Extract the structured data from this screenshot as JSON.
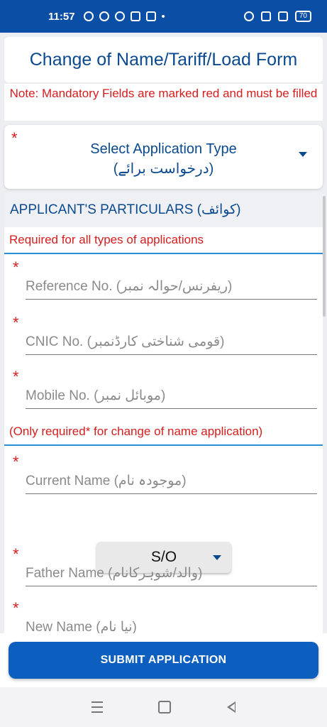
{
  "status": {
    "time": "11:57",
    "battery": "70"
  },
  "form": {
    "title": "Change of Name/Tariff/Load Form",
    "note": "Note: Mandatory Fields are marked red and must be filled"
  },
  "application_type": {
    "asterisk": "*",
    "label": "Select Application Type",
    "urdu": "(درخواست برائے)"
  },
  "applicant": {
    "heading": "APPLICANT'S PARTICULARS (کوائف)",
    "required_note": "Required for all types of applications",
    "fields": [
      {
        "placeholder": "Reference No. (ریفرنس/حوالہ نمبر)"
      },
      {
        "placeholder": "CNIC No. (قومی شناختی کارڈنمبر)"
      },
      {
        "placeholder": "Mobile No. (موبائل نمبر)"
      }
    ]
  },
  "name_change": {
    "note": "(Only required* for change of name application)",
    "current_name": "Current Name (موجودہ نام)",
    "relation": "S/O",
    "father_name": "Father Name (والد/شوہرکانام)",
    "new_name": "New Name (نیا نام)"
  },
  "submit": {
    "label": "SUBMIT APPLICATION"
  }
}
